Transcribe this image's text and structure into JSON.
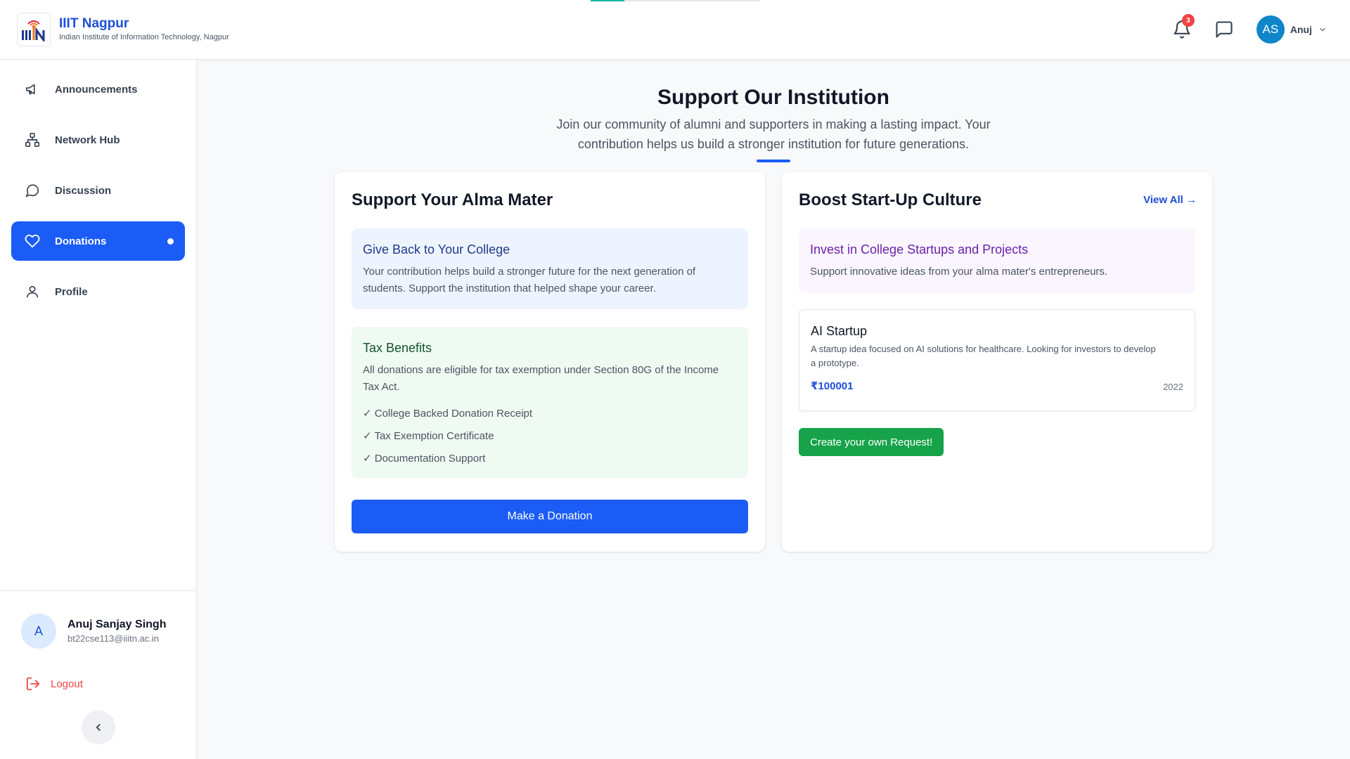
{
  "header": {
    "brand_title": "IIIT Nagpur",
    "brand_subtitle": "Indian Institute of Information Technology, Nagpur",
    "notification_count": "3",
    "avatar_initials": "AS",
    "user_name": "Anuj"
  },
  "sidebar": {
    "items": [
      {
        "label": "Announcements",
        "icon": "megaphone-icon"
      },
      {
        "label": "Network Hub",
        "icon": "network-icon"
      },
      {
        "label": "Discussion",
        "icon": "chat-bubble-icon"
      },
      {
        "label": "Donations",
        "icon": "heart-icon",
        "active": true
      },
      {
        "label": "Profile",
        "icon": "user-icon"
      }
    ],
    "profile": {
      "initial": "A",
      "name": "Anuj Sanjay Singh",
      "email": "bt22cse113@iiitn.ac.in"
    },
    "logout_label": "Logout"
  },
  "hero": {
    "title": "Support Our Institution",
    "subtitle": "Join our community of alumni and supporters in making a lasting impact. Your contribution helps us build a stronger institution for future generations."
  },
  "alma_mater": {
    "title": "Support Your Alma Mater",
    "give_back": {
      "title": "Give Back to Your College",
      "text": "Your contribution helps build a stronger future for the next generation of students. Support the institution that helped shape your career."
    },
    "tax": {
      "title": "Tax Benefits",
      "text": "All donations are eligible for tax exemption under Section 80G of the Income Tax Act.",
      "items": [
        "✓ College Backed Donation Receipt",
        "✓ Tax Exemption Certificate",
        "✓ Documentation Support"
      ]
    },
    "donate_label": "Make a Donation"
  },
  "startup": {
    "title": "Boost Start-Up Culture",
    "view_all": "View All →",
    "invest": {
      "title": "Invest in College Startups and Projects",
      "text": "Support innovative ideas from your alma mater's entrepreneurs."
    },
    "card": {
      "title": "AI Startup",
      "desc": "A startup idea focused on AI solutions for healthcare. Looking for investors to develop a prototype.",
      "amount": "₹100001",
      "year": "2022"
    },
    "create_label": "Create your own Request!"
  },
  "colors": {
    "primary": "#1a5cf5",
    "success": "#16a34a",
    "danger": "#ef4444",
    "brand_blue": "#1d4ed8"
  }
}
